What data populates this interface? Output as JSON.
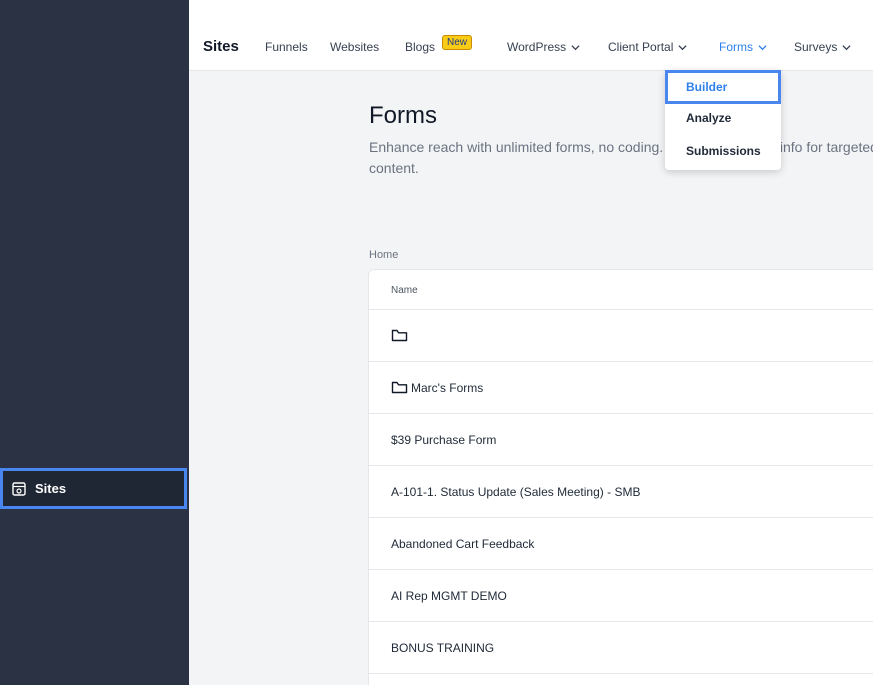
{
  "sidebar": {
    "active_item": {
      "label": "Sites",
      "icon": "sites-icon"
    }
  },
  "topnav": {
    "title": "Sites",
    "items": [
      {
        "label": "Funnels"
      },
      {
        "label": "Websites"
      },
      {
        "label": "Blogs",
        "badge": "New"
      },
      {
        "label": "WordPress",
        "has_chevron": true
      },
      {
        "label": "Client Portal",
        "has_chevron": true
      },
      {
        "label": "Forms",
        "has_chevron": true,
        "active": true
      },
      {
        "label": "Surveys",
        "has_chevron": true
      }
    ]
  },
  "dropdown": {
    "items": [
      {
        "label": "Builder",
        "selected": true
      },
      {
        "label": "Analyze"
      },
      {
        "label": "Submissions"
      }
    ]
  },
  "main": {
    "title": "Forms",
    "description": "Enhance reach with unlimited forms, no coding. Capture essential info for targeted content.",
    "breadcrumb": "Home",
    "table": {
      "header": "Name",
      "rows": [
        {
          "label": "",
          "folder": true
        },
        {
          "label": "Marc's Forms",
          "folder": true
        },
        {
          "label": "$39 Purchase Form"
        },
        {
          "label": "A-101-1. Status Update (Sales Meeting) - SMB"
        },
        {
          "label": "Abandoned Cart Feedback"
        },
        {
          "label": "AI Rep MGMT DEMO"
        },
        {
          "label": "BONUS TRAINING"
        }
      ]
    }
  },
  "colors": {
    "sidebar": "#2a3244",
    "accent": "#2f80ed",
    "highlight": "#4a86f0",
    "badge": "#facc15"
  }
}
